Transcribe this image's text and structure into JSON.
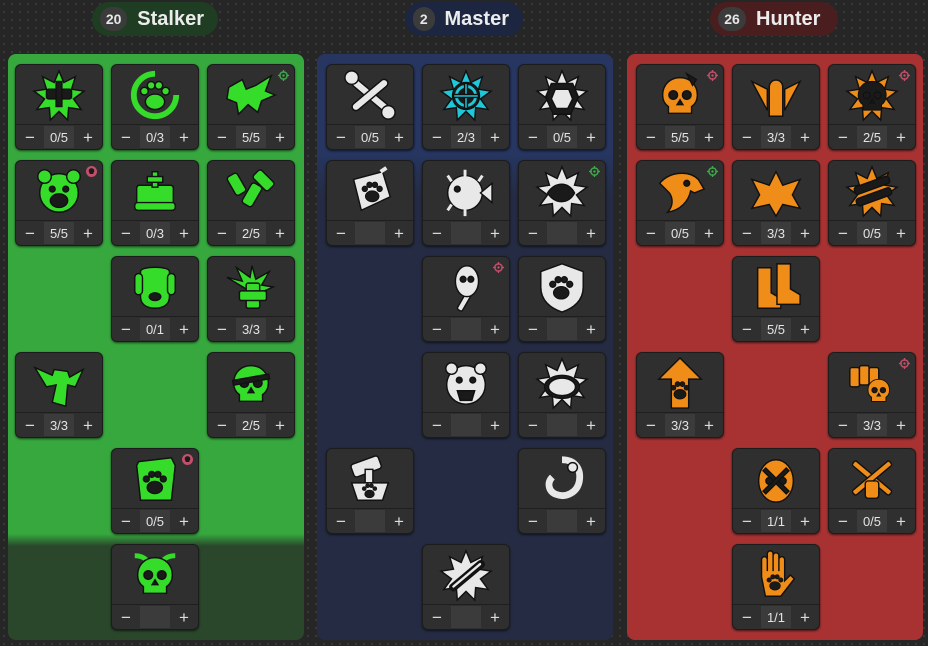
{
  "colors": {
    "stalker": "#36a83e",
    "master": "#263660",
    "hunter": "#a83232",
    "stalker_icon": "#35dc2a",
    "master_icon": "#e8e8e8",
    "master_highlight": "#1ec8d8",
    "hunter_icon": "#f08c18"
  },
  "trees": [
    {
      "name": "Stalker",
      "points": "20",
      "perks": [
        {
          "icon": "cracked-blade-icon",
          "value": "0/5",
          "badge": ""
        },
        {
          "icon": "animal-paw-icon",
          "value": "0/3",
          "badge": ""
        },
        {
          "icon": "winged-weapon-icon",
          "value": "5/5",
          "badge": "crosshair"
        },
        {
          "icon": "bear-head-icon",
          "value": "5/5",
          "badge": "skull"
        },
        {
          "icon": "medkit-stack-icon",
          "value": "0/3",
          "badge": ""
        },
        {
          "icon": "bullet-casings-icon",
          "value": "2/5",
          "badge": ""
        },
        {
          "icon": "dog-head-icon",
          "value": "0/1",
          "badge": ""
        },
        {
          "icon": "winged-cross-icon",
          "value": "3/3",
          "badge": ""
        },
        {
          "icon": "winged-shield-icon",
          "value": "3/3",
          "badge": ""
        },
        {
          "icon": "bandaged-skull-icon",
          "value": "2/5",
          "badge": ""
        },
        {
          "icon": "bait-bag-icon",
          "value": "0/5",
          "badge": "skull"
        },
        {
          "icon": "skull-axes-icon",
          "value": "",
          "badge": ""
        }
      ]
    },
    {
      "name": "Master",
      "points": "2",
      "perks": [
        {
          "icon": "crossed-wrench-icon",
          "value": "0/5",
          "badge": ""
        },
        {
          "icon": "crosshair-burst-icon",
          "value": "2/3",
          "badge": ""
        },
        {
          "icon": "tiger-icon",
          "value": "0/5",
          "badge": ""
        },
        {
          "icon": "paw-tag-icon",
          "value": "",
          "badge": ""
        },
        {
          "icon": "pufferfish-icon",
          "value": "",
          "badge": ""
        },
        {
          "icon": "fish-burst-icon",
          "value": "",
          "badge": "crosshair"
        },
        {
          "icon": "spirit-torch-icon",
          "value": "",
          "badge": "crosshair-red"
        },
        {
          "icon": "paw-shield-icon",
          "value": "",
          "badge": ""
        },
        {
          "icon": "bear-roar-icon",
          "value": "",
          "badge": ""
        },
        {
          "icon": "turtle-shell-icon",
          "value": "",
          "badge": ""
        },
        {
          "icon": "paw-hammer-icon",
          "value": "",
          "badge": ""
        },
        {
          "icon": "coiled-fish-icon",
          "value": "",
          "badge": ""
        },
        {
          "icon": "spiked-bat-icon",
          "value": "",
          "badge": ""
        }
      ]
    },
    {
      "name": "Hunter",
      "points": "26",
      "perks": [
        {
          "icon": "dented-skull-icon",
          "value": "5/5",
          "badge": "crosshair-red"
        },
        {
          "icon": "winged-bullet-icon",
          "value": "3/3",
          "badge": ""
        },
        {
          "icon": "skull-badge-icon",
          "value": "2/5",
          "badge": "crosshair-red"
        },
        {
          "icon": "eagle-head-icon",
          "value": "0/5",
          "badge": "crosshair"
        },
        {
          "icon": "winged-beast-icon",
          "value": "3/3",
          "badge": ""
        },
        {
          "icon": "twin-barrel-icon",
          "value": "0/5",
          "badge": ""
        },
        {
          "icon": "boots-icon",
          "value": "5/5",
          "badge": ""
        },
        {
          "icon": "paw-arrow-icon",
          "value": "3/3",
          "badge": ""
        },
        {
          "icon": "ammo-skull-icon",
          "value": "3/3",
          "badge": "crosshair-red"
        },
        {
          "icon": "crossed-skull-icon",
          "value": "1/1",
          "badge": ""
        },
        {
          "icon": "crossed-blades-icon",
          "value": "0/5",
          "badge": ""
        },
        {
          "icon": "paw-hand-icon",
          "value": "1/1",
          "badge": ""
        }
      ]
    }
  ],
  "controls": {
    "minus": "−",
    "plus": "+"
  }
}
